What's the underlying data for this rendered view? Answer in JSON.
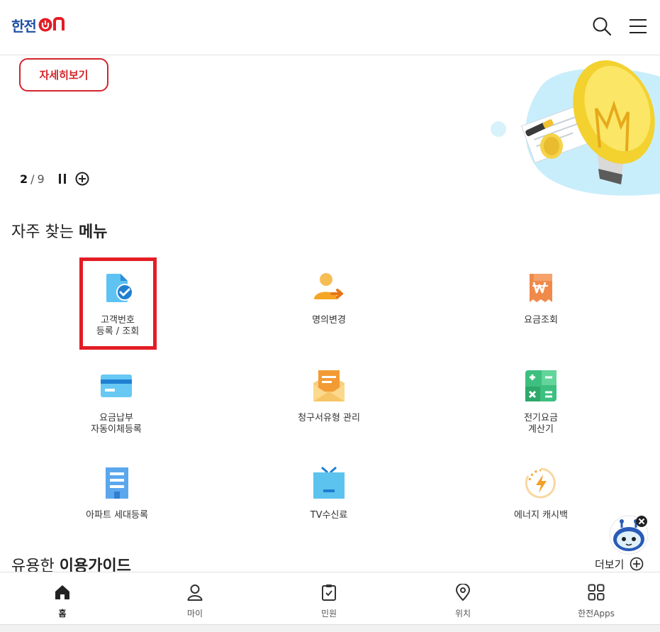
{
  "header": {
    "logo_text": "한전",
    "logo_on": "ON",
    "brand_color": "#1f4fa3",
    "accent_color": "#e31d25"
  },
  "banner": {
    "detail_label": "자세히보기",
    "pager_current": "2",
    "pager_sep": "/",
    "pager_total": "9"
  },
  "frequent_menu": {
    "title_normal": "자주 찾는 ",
    "title_bold": "메뉴",
    "items": [
      {
        "line1": "고객번호",
        "line2": "등록 / 조회",
        "icon": "document-check-icon"
      },
      {
        "line1": "명의변경",
        "line2": "",
        "icon": "person-transfer-icon"
      },
      {
        "line1": "요금조회",
        "line2": "",
        "icon": "won-receipt-icon"
      },
      {
        "line1": "요금납부",
        "line2": "자동이체등록",
        "icon": "card-icon"
      },
      {
        "line1": "청구서유형 관리",
        "line2": "",
        "icon": "envelope-icon"
      },
      {
        "line1": "전기요금",
        "line2": "계산기",
        "icon": "calculator-icon"
      },
      {
        "line1": "아파트 세대등록",
        "line2": "",
        "icon": "apartment-icon"
      },
      {
        "line1": "TV수신료",
        "line2": "",
        "icon": "tv-icon"
      },
      {
        "line1": "에너지 캐시백",
        "line2": "",
        "icon": "energy-cashback-icon"
      }
    ]
  },
  "guide": {
    "title_normal": "유용한 ",
    "title_bold": "이용가이드",
    "more_label": "더보기"
  },
  "bottom_nav": {
    "items": [
      {
        "label": "홈",
        "icon": "home-icon"
      },
      {
        "label": "마이",
        "icon": "user-icon"
      },
      {
        "label": "민원",
        "icon": "clipboard-check-icon"
      },
      {
        "label": "위치",
        "icon": "location-pin-icon"
      },
      {
        "label": "한전Apps",
        "icon": "apps-grid-icon"
      }
    ]
  }
}
